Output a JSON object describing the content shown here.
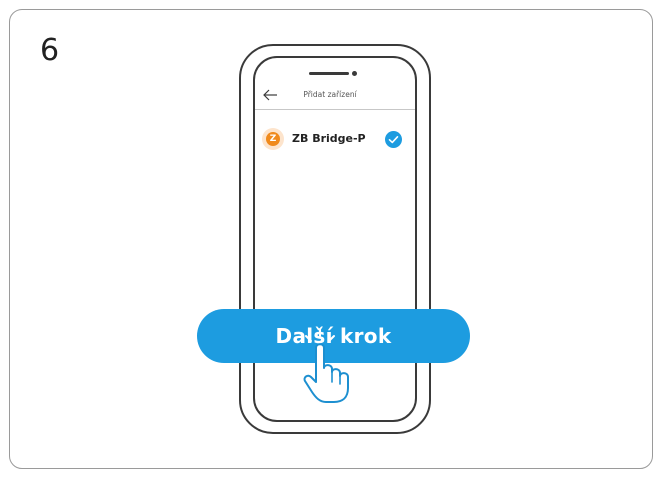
{
  "step": {
    "number": "6"
  },
  "app": {
    "header_title": "Přidat zařízení",
    "back_icon": "arrow-left-icon"
  },
  "device": {
    "name": "ZB Bridge-P",
    "logo_letter": "Z",
    "logo_icon": "zigbee-logo-icon",
    "selected": true,
    "check_icon": "check-circle-icon"
  },
  "button": {
    "label": "Další krok"
  },
  "pointer": {
    "icon": "hand-pointer-icon"
  },
  "colors": {
    "accent": "#1d9ce0",
    "logo_orange": "#f08a1c",
    "outline": "#3a3a3a",
    "card_border": "#9a9a9a"
  }
}
